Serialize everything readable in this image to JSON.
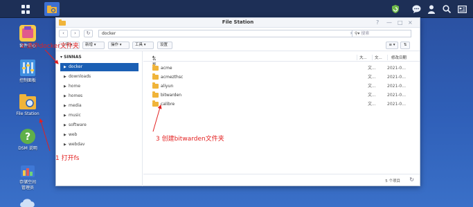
{
  "taskbar": {
    "tray_icons": [
      "refresh-shield-icon",
      "chat-icon",
      "user-icon",
      "search-icon",
      "widget-icon"
    ]
  },
  "desktop": {
    "icons": [
      {
        "name": "package-center",
        "label": "套件中心"
      },
      {
        "name": "control-panel",
        "label": "控制面板"
      },
      {
        "name": "file-station",
        "label": "File Station"
      },
      {
        "name": "dsm-help",
        "label": "DSM 说明"
      },
      {
        "name": "storage-manager",
        "label": "存储空间\n管理员"
      }
    ]
  },
  "window": {
    "title": "File Station",
    "controls": [
      "?",
      "—",
      "□",
      "×"
    ],
    "path": "docker",
    "search_placeholder": "搜索",
    "toolbar": {
      "upload": "上传",
      "create": "新增",
      "action": "操作",
      "tools": "工具",
      "settings": "设置"
    },
    "tree": {
      "root": "SINNAS",
      "items": [
        "docker",
        "downloads",
        "home",
        "homes",
        "media",
        "music",
        "software",
        "web",
        "webdav"
      ],
      "selected": "docker"
    },
    "columns": {
      "name": "名称",
      "size": "大...",
      "type": "文...",
      "modified": "修改日期"
    },
    "files": [
      {
        "name": "acme",
        "type": "文...",
        "modified": "2021-0..."
      },
      {
        "name": "acmezthsc",
        "type": "文...",
        "modified": "2021-0..."
      },
      {
        "name": "aliyun",
        "type": "文...",
        "modified": "2021-0..."
      },
      {
        "name": "bitwarden",
        "type": "文...",
        "modified": "2021-0..."
      },
      {
        "name": "calibre",
        "type": "文...",
        "modified": "2021-0..."
      }
    ],
    "status": {
      "count": "5 个项目"
    }
  },
  "annotations": {
    "a1": "1 打开fs",
    "a2": "2 选中docker文件夹",
    "a3": "3 创建bitwarden文件夹"
  },
  "colors": {
    "annotation": "#e32020",
    "selection": "#1b5fb4",
    "folder": "#f0b43a"
  }
}
